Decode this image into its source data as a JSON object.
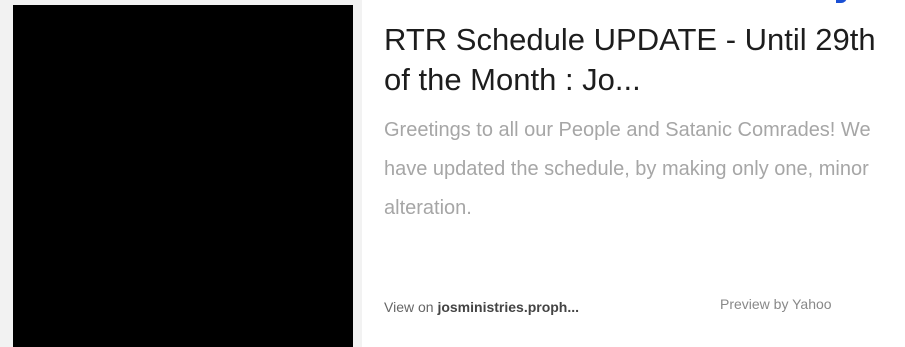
{
  "card": {
    "title": "RTR Schedule UPDATE - Until 29th of the Month : Jo...",
    "description": "Greetings to all our People and Satanic Comrades! We have updated the schedule, by making only one, minor alteration.",
    "view_on_prefix": "View on ",
    "domain": "josministries.proph...",
    "preview_by": "Preview by Yahoo"
  },
  "colors": {
    "title": "#1d1d1d",
    "description": "#a6a6a6",
    "thumbnail": "#000000",
    "link_accent": "#1a4fd4"
  }
}
